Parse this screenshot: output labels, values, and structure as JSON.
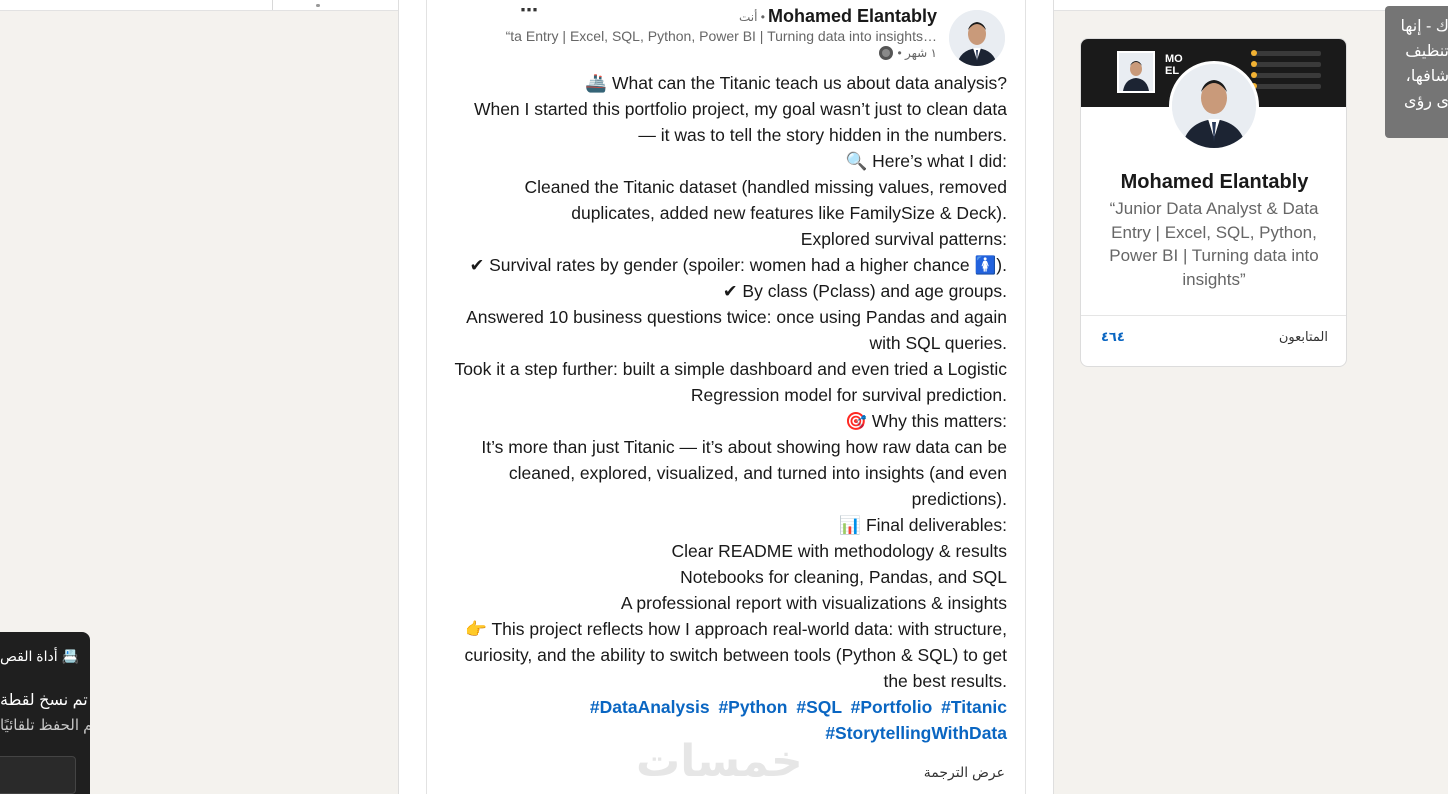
{
  "post": {
    "author_name": "Mohamed Elantably",
    "you_tag": "• أنت",
    "more_icon": "⋯",
    "headline": "“ta Entry | Excel, SQL, Python, Power BI | Turning data into insights…",
    "time": "١ شهر •",
    "lines": [
      "🚢 What can the Titanic teach us about data analysis?",
      "When I started this portfolio project, my goal wasn’t just to clean data",
      "— it was to tell the story hidden in the numbers.",
      "🔍 Here’s what I did:",
      "Cleaned the Titanic dataset (handled missing values, removed",
      "duplicates, added new features like FamilySize & Deck).",
      "Explored survival patterns:",
      "✔ Survival rates by gender (spoiler: women had a higher chance 🚺).",
      "✔ By class (Pclass) and age groups.",
      "Answered 10 business questions twice: once using Pandas and again",
      "with SQL queries.",
      "Took it a step further: built a simple dashboard and even tried a Logistic",
      "Regression model for survival prediction.",
      "🎯 Why this matters:",
      "It’s more than just Titanic — it’s about showing how raw data can be",
      "cleaned, explored, visualized, and turned into insights (and even",
      "predictions).",
      "📊 Final deliverables:",
      "Clear README with methodology & results",
      "Notebooks for cleaning, Pandas, and SQL",
      "A professional report with visualizations & insights",
      "👉 This project reflects how I approach real-world data: with structure,",
      "curiosity, and the ability to switch between tools (Python & SQL) to get",
      "the best results."
    ],
    "hashtags_line1": [
      "#DataAnalysis",
      "#Python",
      "#SQL",
      "#Portfolio",
      "#Titanic"
    ],
    "hashtags_line2": [
      "#StorytellingWithData"
    ],
    "translate_label": "عرض الترجمة",
    "watermark": "خمسات"
  },
  "profile_card": {
    "name": "Mohamed Elantably",
    "headline": "“Junior Data Analyst & Data Entry | Excel, SQL, Python, Power BI | Turning data into insights”",
    "banner_text": "MO\nEL",
    "followers_label": "المتابعون",
    "followers_count": "٤٦٤"
  },
  "tooltip_right": {
    "lines": [
      "ك - إنها",
      "تنظيف",
      "شافها،",
      "ى رؤى"
    ]
  },
  "toast": {
    "title": "📇 أداة القص",
    "message": "تم نسخ لقطة",
    "sub": "تم الحفظ تلقائيًا"
  },
  "colors": {
    "link": "#0a66c2",
    "background": "#f4f2ee",
    "tooltip": "#757575",
    "toast": "#1f1f1f"
  }
}
